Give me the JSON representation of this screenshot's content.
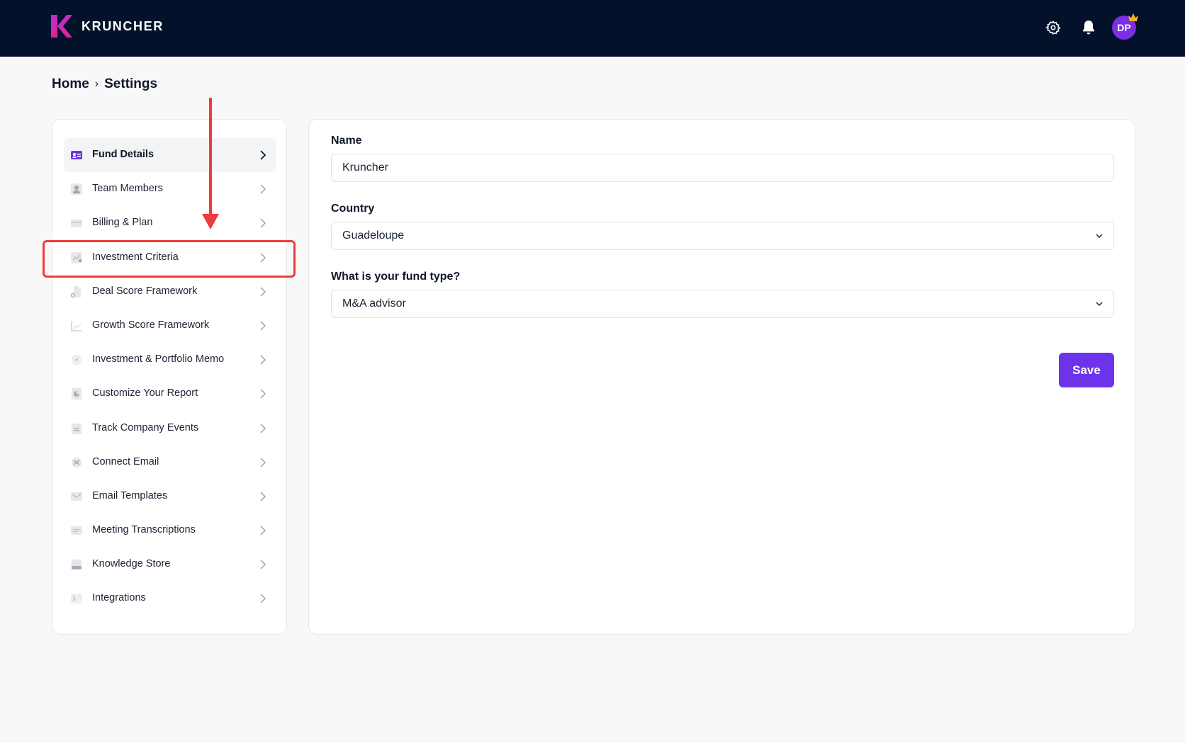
{
  "app": {
    "brand": "KRUNCHER",
    "avatar_initials": "DP"
  },
  "colors": {
    "topbar": "#03112b",
    "accent": "#6d33ea",
    "avatar": "#7a2fe0",
    "annotation": "#ef3b3b"
  },
  "breadcrumb": {
    "home": "Home",
    "separator": "›",
    "current": "Settings"
  },
  "sidebar": {
    "items": [
      {
        "label": "Fund Details",
        "icon": "id-card-icon",
        "active": true
      },
      {
        "label": "Team Members",
        "icon": "user-icon"
      },
      {
        "label": "Billing & Plan",
        "icon": "credit-card-icon"
      },
      {
        "label": "Investment Criteria",
        "icon": "criteria-icon",
        "highlighted": true
      },
      {
        "label": "Deal Score Framework",
        "icon": "framework-icon"
      },
      {
        "label": "Growth Score Framework",
        "icon": "chart-icon"
      },
      {
        "label": "Investment & Portfolio Memo",
        "icon": "memo-icon"
      },
      {
        "label": "Customize Your Report",
        "icon": "report-icon"
      },
      {
        "label": "Track Company Events",
        "icon": "events-icon"
      },
      {
        "label": "Connect Email",
        "icon": "connect-icon"
      },
      {
        "label": "Email Templates",
        "icon": "mail-icon"
      },
      {
        "label": "Meeting Transcriptions",
        "icon": "transcript-icon"
      },
      {
        "label": "Knowledge Store",
        "icon": "database-icon"
      },
      {
        "label": "Integrations",
        "icon": "terminal-icon"
      }
    ]
  },
  "form": {
    "name": {
      "label": "Name",
      "value": "Kruncher"
    },
    "country": {
      "label": "Country",
      "value": "Guadeloupe"
    },
    "fund_type": {
      "label": "What is your fund type?",
      "value": "M&A advisor"
    },
    "save_label": "Save"
  }
}
